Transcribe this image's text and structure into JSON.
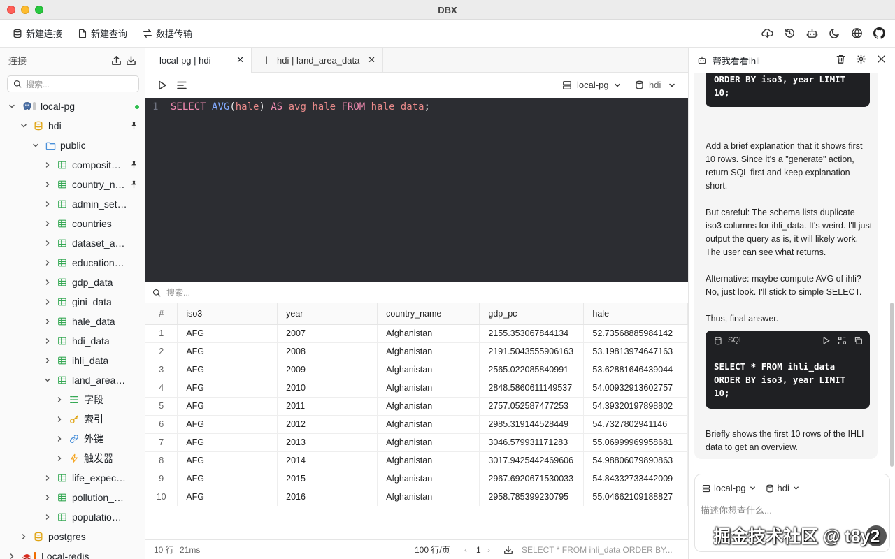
{
  "window": {
    "title": "DBX"
  },
  "toolbar": {
    "new_connection": "新建连接",
    "new_query": "新建查询",
    "data_transfer": "数据传输",
    "right_icons": [
      "cloud-download-icon",
      "history-icon",
      "ai-bot-icon",
      "moon-icon",
      "globe-icon",
      "github-icon"
    ]
  },
  "sidebar": {
    "header": "连接",
    "search_placeholder": "搜索...",
    "tree": [
      {
        "label": "local-pg",
        "level": 0,
        "icon": "postgres-icon",
        "open": true,
        "connected": true
      },
      {
        "label": "hdi",
        "level": 1,
        "icon": "database-icon",
        "open": true,
        "pinned": true
      },
      {
        "label": "public",
        "level": 2,
        "icon": "folder-icon",
        "open": true
      },
      {
        "label": "composit…",
        "level": 3,
        "icon": "table-icon",
        "pinned": true
      },
      {
        "label": "country_n…",
        "level": 3,
        "icon": "table-icon",
        "pinned": true
      },
      {
        "label": "admin_set…",
        "level": 3,
        "icon": "table-icon"
      },
      {
        "label": "countries",
        "level": 3,
        "icon": "table-icon"
      },
      {
        "label": "dataset_a…",
        "level": 3,
        "icon": "table-icon"
      },
      {
        "label": "education…",
        "level": 3,
        "icon": "table-icon"
      },
      {
        "label": "gdp_data",
        "level": 3,
        "icon": "table-icon"
      },
      {
        "label": "gini_data",
        "level": 3,
        "icon": "table-icon"
      },
      {
        "label": "hale_data",
        "level": 3,
        "icon": "table-icon"
      },
      {
        "label": "hdi_data",
        "level": 3,
        "icon": "table-icon"
      },
      {
        "label": "ihli_data",
        "level": 3,
        "icon": "table-icon"
      },
      {
        "label": "land_area…",
        "level": 3,
        "icon": "table-icon",
        "open": true
      },
      {
        "label": "字段",
        "level": 4,
        "icon": "columns-icon"
      },
      {
        "label": "索引",
        "level": 4,
        "icon": "key-icon"
      },
      {
        "label": "外键",
        "level": 4,
        "icon": "link-icon"
      },
      {
        "label": "触发器",
        "level": 4,
        "icon": "bolt-icon"
      },
      {
        "label": "life_expec…",
        "level": 3,
        "icon": "table-icon"
      },
      {
        "label": "pollution_…",
        "level": 3,
        "icon": "table-icon"
      },
      {
        "label": "populatio…",
        "level": 3,
        "icon": "table-icon"
      },
      {
        "label": "postgres",
        "level": 1,
        "icon": "database-icon"
      },
      {
        "label": "Local-redis",
        "level": 0,
        "icon": "redis-icon"
      }
    ]
  },
  "tabs": [
    {
      "label": "local-pg | hdi",
      "active": true
    },
    {
      "label": "hdi | land_area_data",
      "active": false
    }
  ],
  "editor": {
    "connection": "local-pg",
    "database": "hdi",
    "line_number": "1",
    "sql": {
      "kw1": "SELECT",
      "fn": "AVG",
      "col": "hale",
      "kw2": "AS",
      "alias": "avg_hale",
      "kw3": "FROM",
      "table": "hale_data"
    }
  },
  "results": {
    "search_placeholder": "搜索...",
    "columns": [
      "#",
      "iso3",
      "year",
      "country_name",
      "gdp_pc",
      "hale"
    ],
    "rows": [
      [
        "1",
        "AFG",
        "2007",
        "Afghanistan",
        "2155.353067844134",
        "52.73568885984142"
      ],
      [
        "2",
        "AFG",
        "2008",
        "Afghanistan",
        "2191.5043555906163",
        "53.19813974647163"
      ],
      [
        "3",
        "AFG",
        "2009",
        "Afghanistan",
        "2565.022085840991",
        "53.62881646439044"
      ],
      [
        "4",
        "AFG",
        "2010",
        "Afghanistan",
        "2848.5860611149537",
        "54.00932913602757"
      ],
      [
        "5",
        "AFG",
        "2011",
        "Afghanistan",
        "2757.052587477253",
        "54.39320197898802"
      ],
      [
        "6",
        "AFG",
        "2012",
        "Afghanistan",
        "2985.319144528449",
        "54.7327802941146"
      ],
      [
        "7",
        "AFG",
        "2013",
        "Afghanistan",
        "3046.579931171283",
        "55.06999969958681"
      ],
      [
        "8",
        "AFG",
        "2014",
        "Afghanistan",
        "3017.9425442469606",
        "54.98806079890863"
      ],
      [
        "9",
        "AFG",
        "2015",
        "Afghanistan",
        "2967.6920671530033",
        "54.84332733442009"
      ],
      [
        "10",
        "AFG",
        "2016",
        "Afghanistan",
        "2958.785399230795",
        "55.04662109188827"
      ]
    ]
  },
  "status": {
    "rows": "10 行",
    "time": "21ms",
    "page_size": "100 行/页",
    "page": "1",
    "query": "SELECT * FROM ihli_data ORDER BY..."
  },
  "chat": {
    "title": "帮我看看ihli",
    "top_code_lines": [
      "ORDER BY iso3, year LIMIT",
      "10;"
    ],
    "paragraphs": [
      "Add a brief explanation that it shows first 10 rows. Since it's a \"generate\" action, return SQL first and keep explanation short.",
      "But careful: The schema lists duplicate iso3 columns for ihli_data. It's weird. I'll just output the query as is, it will likely work. The user can see what returns.",
      "Alternative: maybe compute AVG of ihli? No, just look. I'll stick to simple SELECT.",
      "Thus, final answer."
    ],
    "code_lang": "SQL",
    "code_lines": [
      "SELECT * FROM ihli_data",
      "ORDER BY iso3, year LIMIT",
      "10;"
    ],
    "summary": "Briefly shows the first 10 rows of the IHLI data to get an overview.",
    "input": {
      "connection": "local-pg",
      "database": "hdi",
      "placeholder": "描述你想查什么..."
    }
  },
  "watermark": "掘金技术社区 @ t8y2"
}
